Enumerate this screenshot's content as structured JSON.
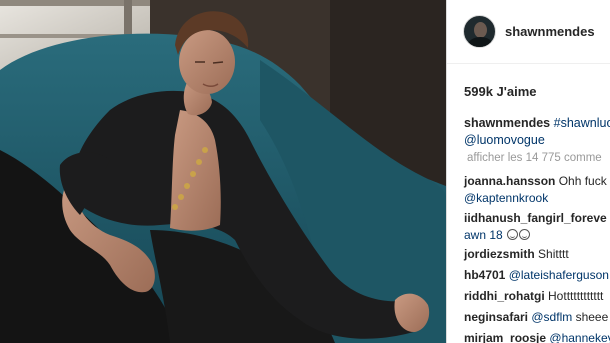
{
  "post": {
    "username": "shawnmendes",
    "likes": "599k J'aime",
    "caption": {
      "username": "shawnmendes",
      "hashtag": "#shawnluo",
      "mention": "@luomovogue"
    },
    "load_more": "afficher les 14 775 comme"
  },
  "comments": [
    {
      "user": "joanna.hansson",
      "text": "Ohh fuck",
      "line2_mention": "@kaptennkrook"
    },
    {
      "user": "iidhanush_fangirl_foreve",
      "line2_text": "awn 18"
    },
    {
      "user": "jordiezsmith",
      "text": "Shitttt"
    },
    {
      "user": "hb4701",
      "mention": "@lateishaferguson"
    },
    {
      "user": "riddhi_rohatgi",
      "text": "Hotttttttttttt"
    },
    {
      "user": "neginsafari",
      "mention": "@sdflm",
      "text": "sheee"
    },
    {
      "user": "mirjam_roosje",
      "mention": "@hannekey"
    }
  ],
  "icons": {
    "avatar": "profile-avatar",
    "emoji": "smiling-face-emoji"
  },
  "colors": {
    "text": "#262626",
    "link": "#003569",
    "muted": "#999999",
    "sofa": "#1f5b6a"
  }
}
